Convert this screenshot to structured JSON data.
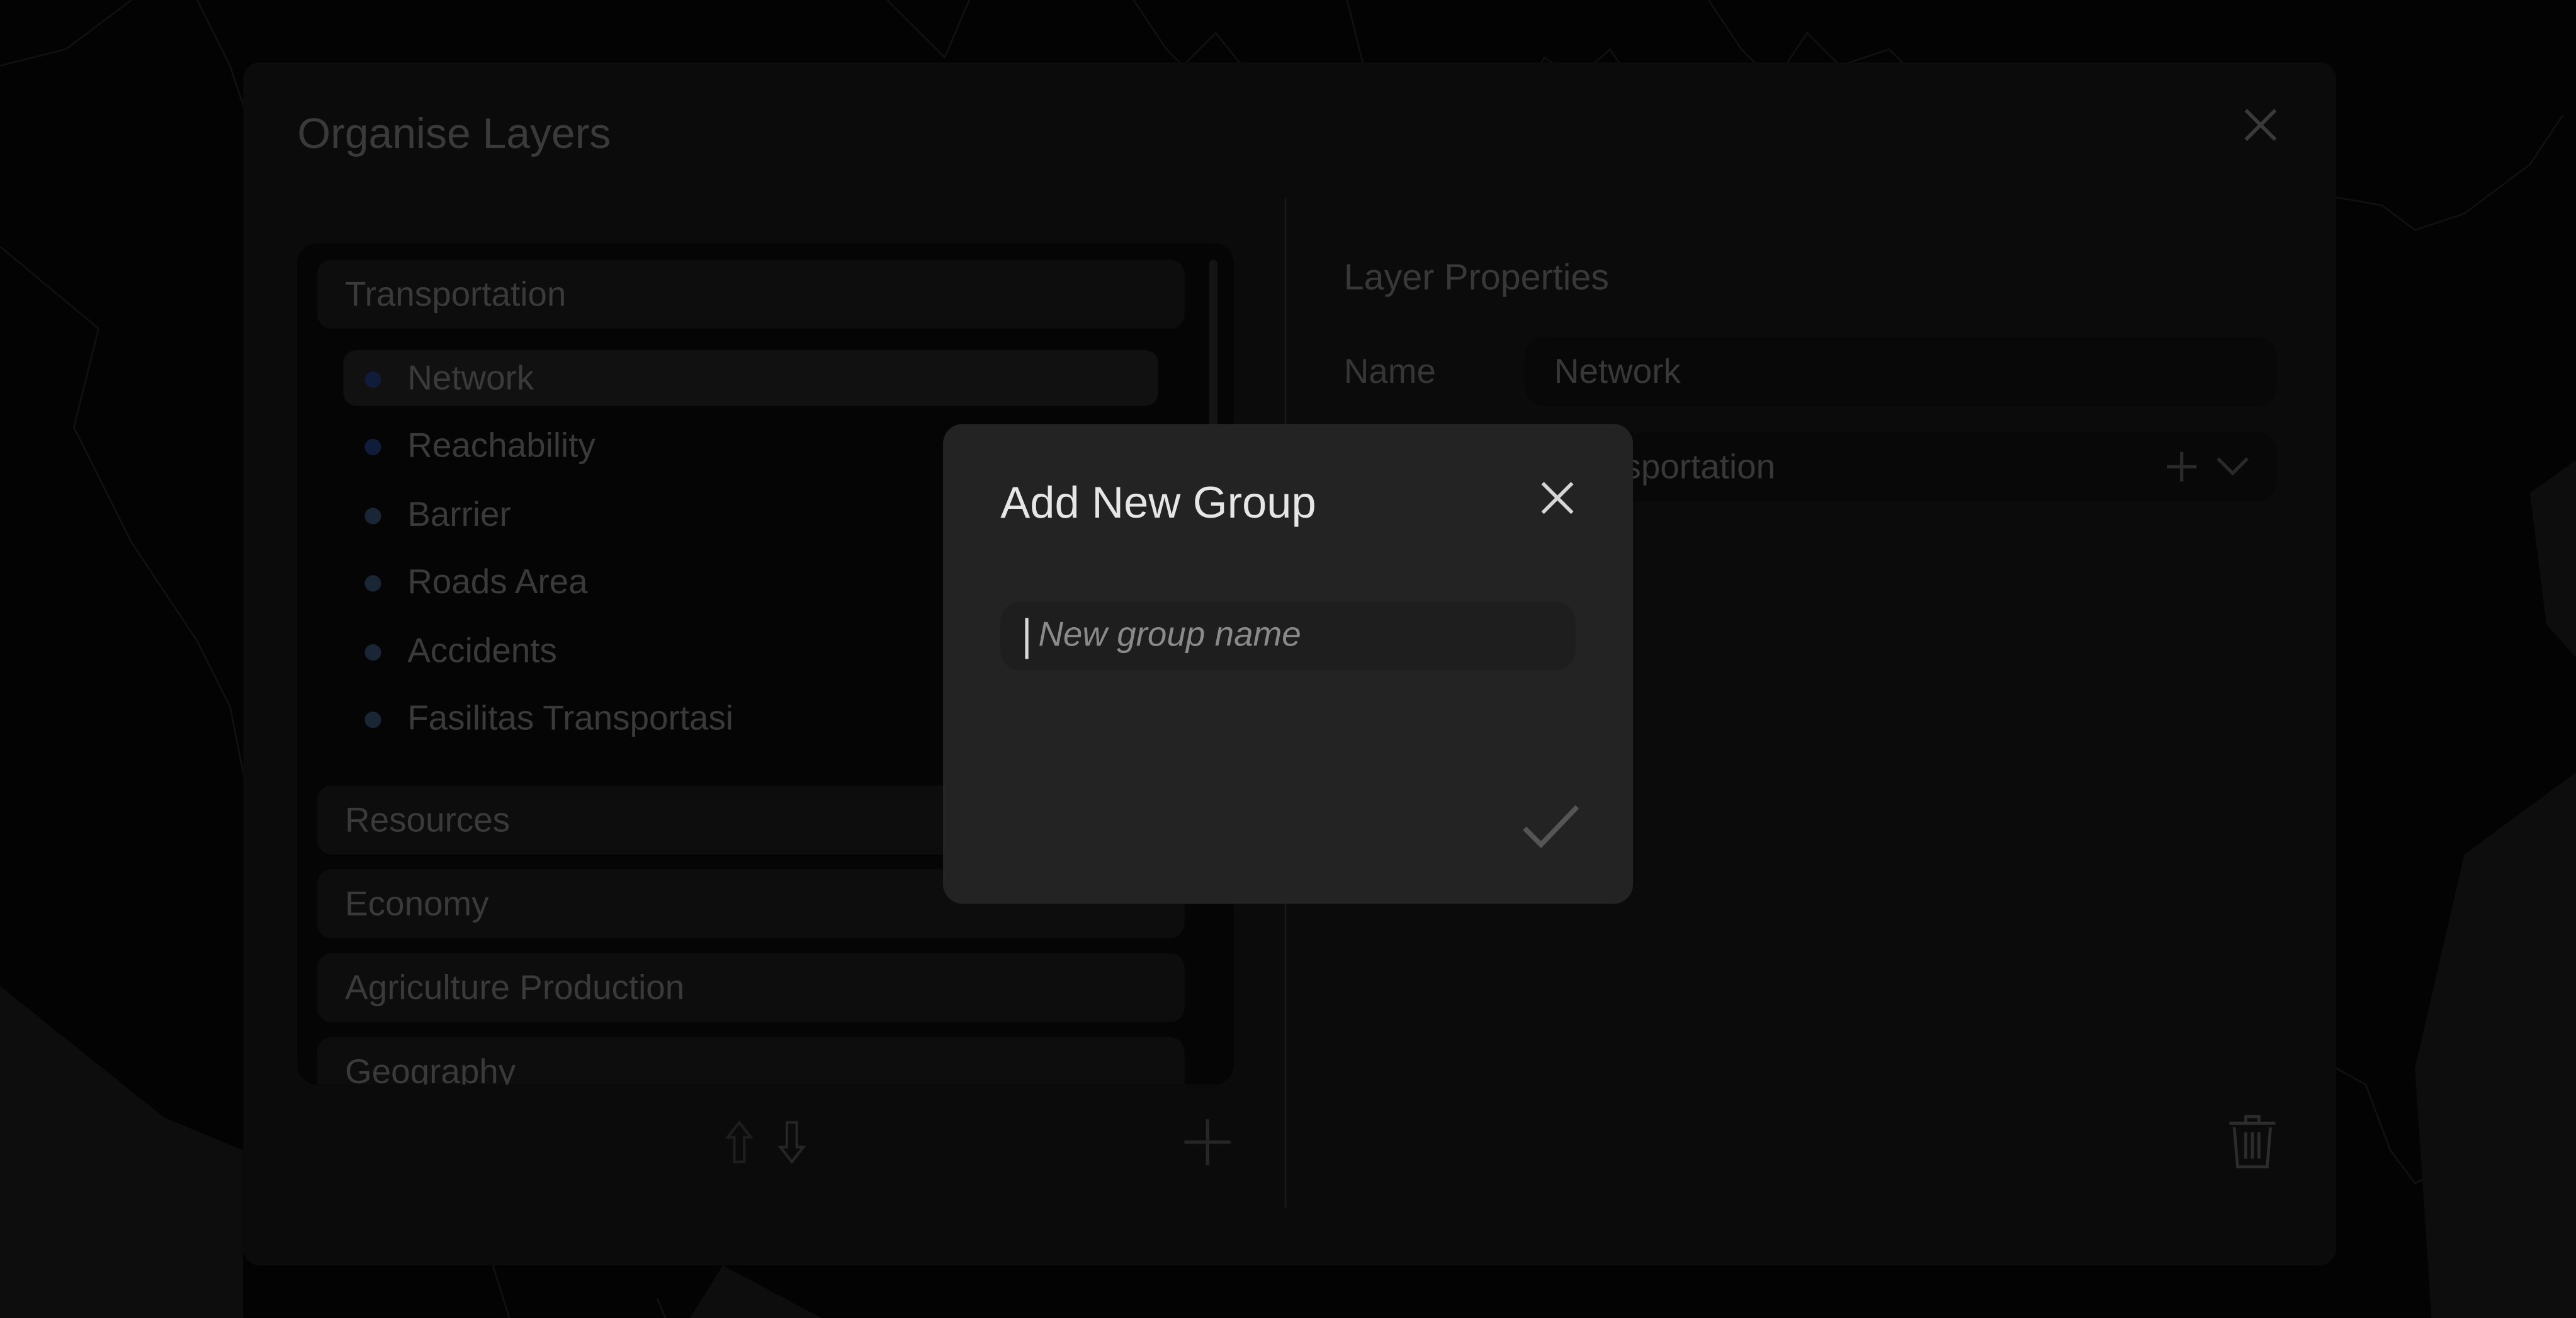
{
  "organise_dialog": {
    "title": "Organise Layers",
    "close_icon": "close-icon",
    "groups": [
      {
        "label": "Transportation",
        "expanded": true,
        "layers": [
          {
            "label": "Network",
            "selected": true,
            "dot_color": "#0f1c3a"
          },
          {
            "label": "Reachability",
            "selected": false,
            "dot_color": "#0f1c3a"
          },
          {
            "label": "Barrier",
            "selected": false,
            "dot_color": "#1a2536"
          },
          {
            "label": "Roads Area",
            "selected": false,
            "dot_color": "#1a2536"
          },
          {
            "label": "Accidents",
            "selected": false,
            "dot_color": "#1a2536"
          },
          {
            "label": "Fasilitas Transportasi",
            "selected": false,
            "dot_color": "#1a2536"
          }
        ]
      },
      {
        "label": "Resources",
        "expanded": false
      },
      {
        "label": "Economy",
        "expanded": false
      },
      {
        "label": "Agriculture Production",
        "expanded": false
      },
      {
        "label": "Geography",
        "expanded": false
      }
    ],
    "tree_actions": {
      "move_up_icon": "arrow-up-outline-icon",
      "move_down_icon": "arrow-down-outline-icon",
      "add_icon": "plus-icon"
    },
    "layer_properties": {
      "title": "Layer Properties",
      "name_label": "Name",
      "name_value": "Network",
      "group_value": "Transportation",
      "group_add_icon": "plus-icon",
      "group_dropdown_icon": "chevron-down-icon",
      "delete_icon": "trash-icon"
    }
  },
  "add_group_modal": {
    "title": "Add New Group",
    "input_value": "",
    "input_placeholder": "New group name",
    "close_icon": "close-icon",
    "confirm_icon": "checkmark-icon"
  },
  "colors": {
    "modal_bg": "#232323",
    "dialog_bg": "#0b0b0b",
    "map_bg": "#030303",
    "accent_dot": "#0f1c3a"
  }
}
